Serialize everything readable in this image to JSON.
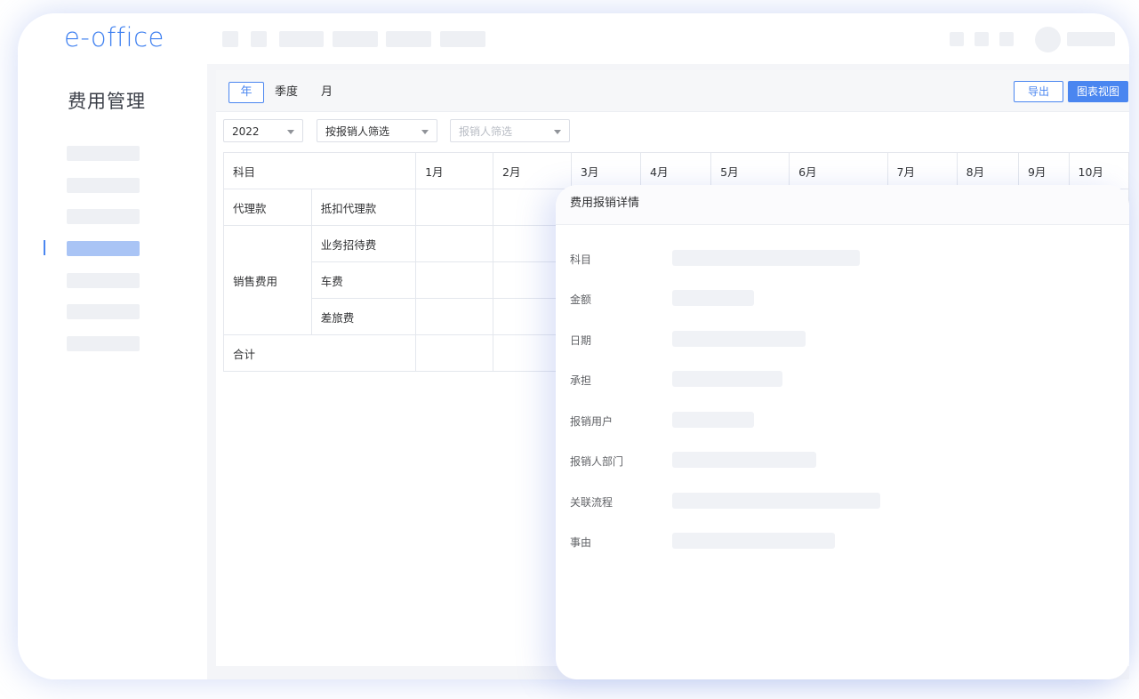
{
  "app": {
    "logo": "e-office"
  },
  "sidebar": {
    "title": "费用管理"
  },
  "toolbar": {
    "tabs": [
      "年",
      "季度",
      "月"
    ],
    "export_label": "导出",
    "chart_view_label": "图表视图"
  },
  "filters": {
    "year_value": "2022",
    "filter_mode_value": "按报销人筛选",
    "reporter_placeholder": "报销人筛选"
  },
  "table": {
    "header_subject": "科目",
    "months": [
      "1月",
      "2月",
      "3月",
      "4月",
      "5月",
      "6月",
      "7月",
      "8月",
      "9月",
      "10月"
    ],
    "groups": {
      "agency": "代理款",
      "agency_item": "抵扣代理款",
      "sales": "销售费用",
      "sales_items": [
        "业务招待费",
        "车费",
        "差旅费"
      ],
      "total": "合计"
    }
  },
  "drawer": {
    "title": "费用报销详情",
    "fields": [
      "科目",
      "金额",
      "日期",
      "承担",
      "报销用户",
      "报销人部门",
      "关联流程",
      "事由"
    ]
  },
  "colors": {
    "accent": "#4a86f0",
    "sidebar_active": "#a9c4f5"
  }
}
